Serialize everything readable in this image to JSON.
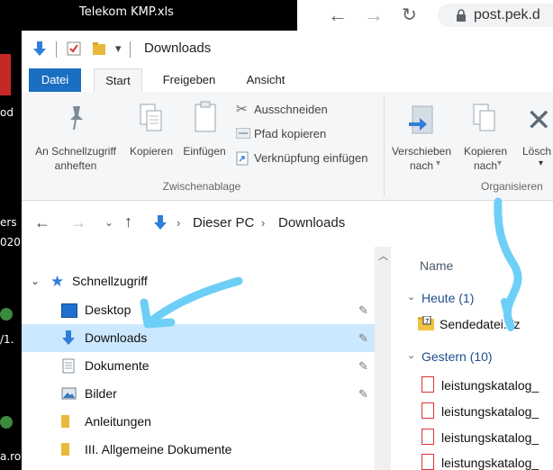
{
  "background": {
    "tab_title": "Telekom KMP.xls",
    "left_fragments": [
      "od",
      "ers",
      "020",
      "/1.",
      "a.ro"
    ]
  },
  "browser": {
    "url": "post.pek.d"
  },
  "explorer": {
    "title": "Downloads",
    "tabs": {
      "file": "Datei",
      "home": "Start",
      "share": "Freigeben",
      "view": "Ansicht"
    },
    "ribbon": {
      "pin_label_1": "An Schnellzugriff",
      "pin_label_2": "anheften",
      "copy": "Kopieren",
      "paste": "Einfügen",
      "cut": "Ausschneiden",
      "copy_path": "Pfad kopieren",
      "paste_shortcut": "Verknüpfung einfügen",
      "group_clipboard": "Zwischenablage",
      "move_to_1": "Verschieben",
      "move_to_2": "nach",
      "copy_to_1": "Kopieren",
      "copy_to_2": "nach",
      "delete": "Lösch",
      "group_organize": "Organisieren"
    },
    "address": {
      "pc": "Dieser PC",
      "folder": "Downloads"
    },
    "nav": {
      "quick": "Schnellzugriff",
      "items": [
        "Desktop",
        "Downloads",
        "Dokumente",
        "Bilder",
        "Anleitungen",
        "III. Allgemeine Dokumente"
      ]
    },
    "list": {
      "column_name": "Name",
      "group_today": "Heute (1)",
      "today_file": "Sendedatei.7z",
      "group_yesterday": "Gestern (10)",
      "yesterday_files": [
        "leistungskatalog_",
        "leistungskatalog_",
        "leistungskatalog_",
        "leistungskatalog_"
      ]
    }
  },
  "colors": {
    "accent": "#1a6fc0",
    "selection": "#cce8ff",
    "annotation": "#6ecff6"
  }
}
